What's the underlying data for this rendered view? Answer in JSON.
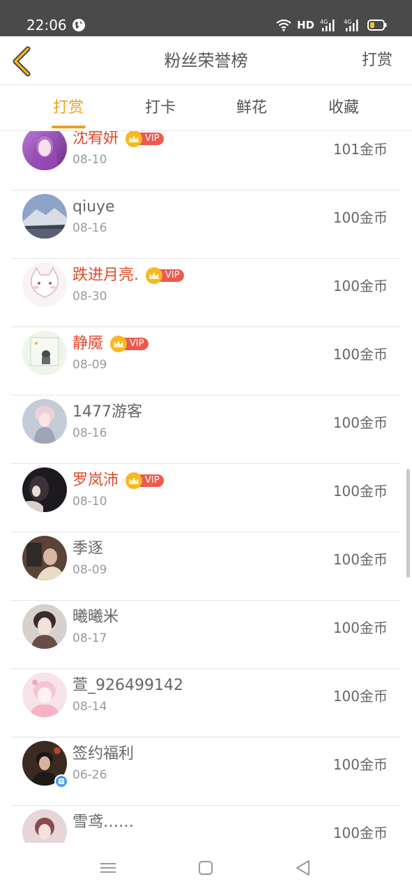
{
  "status_bar": {
    "time": "22:06",
    "hd_label": "HD",
    "network_1": "4G",
    "network_2": "4G",
    "icons": [
      "globe-icon",
      "wifi-icon",
      "signal-icon",
      "battery-icon"
    ]
  },
  "header": {
    "title": "粉丝荣誉榜",
    "right_action": "打赏",
    "back_icon": "chevron-left-icon"
  },
  "tabs": [
    {
      "label": "打赏",
      "active": true
    },
    {
      "label": "打卡",
      "active": false
    },
    {
      "label": "鲜花",
      "active": false
    },
    {
      "label": "收藏",
      "active": false
    }
  ],
  "vip_label": "VIP",
  "accent_color": "#f0a01c",
  "vip_name_color": "#e0492b",
  "fans": [
    {
      "name": "沈宥妍",
      "vip": true,
      "date": "08-10",
      "amount": "101金币"
    },
    {
      "name": "qiuye",
      "vip": false,
      "date": "08-16",
      "amount": "100金币"
    },
    {
      "name": "跌进月亮.",
      "vip": true,
      "date": "08-30",
      "amount": "100金币"
    },
    {
      "name": "静魇",
      "vip": true,
      "date": "08-09",
      "amount": "100金币"
    },
    {
      "name": "1477游客",
      "vip": false,
      "date": "08-16",
      "amount": "100金币"
    },
    {
      "name": "罗岚沛",
      "vip": true,
      "date": "08-10",
      "amount": "100金币"
    },
    {
      "name": "季逐",
      "vip": false,
      "date": "08-09",
      "amount": "100金币"
    },
    {
      "name": "曦曦米",
      "vip": false,
      "date": "08-17",
      "amount": "100金币"
    },
    {
      "name": "萱_926499142",
      "vip": false,
      "date": "08-14",
      "amount": "100金币"
    },
    {
      "name": "签约福利",
      "vip": false,
      "date": "06-26",
      "amount": "100金币"
    },
    {
      "name": "雪鸢……",
      "vip": false,
      "date": "",
      "amount": "100金币"
    }
  ],
  "nav_bar": {
    "icons": [
      "menu-icon",
      "home-icon",
      "back-triangle-icon"
    ]
  }
}
